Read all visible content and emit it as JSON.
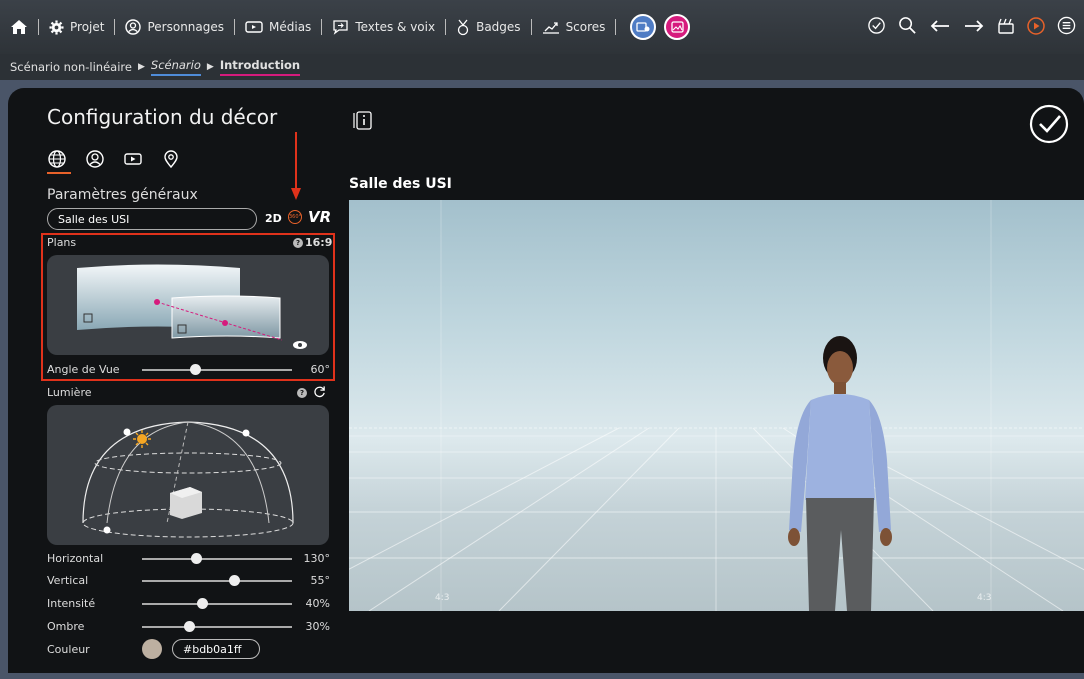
{
  "nav": {
    "projet": "Projet",
    "personnages": "Personnages",
    "medias": "Médias",
    "textes_voix": "Textes & voix",
    "badges": "Badges",
    "scores": "Scores"
  },
  "breadcrumb": {
    "root": "Scénario non-linéaire",
    "scenario": "Scénario",
    "current": "Introduction"
  },
  "panel": {
    "title": "Configuration du décor",
    "section_title": "Paramètres généraux",
    "decor_name": "Salle des USI",
    "mode_2d": "2D",
    "mode_360": "360°",
    "mode_vr": "VR"
  },
  "plans": {
    "label": "Plans",
    "ratio": "16:9",
    "angle_label": "Angle de Vue",
    "angle_value": "60°",
    "angle_level": 0.35
  },
  "lumiere": {
    "label": "Lumière",
    "horizontal_label": "Horizontal",
    "horizontal_value": "130°",
    "horizontal_level": 0.36,
    "vertical_label": "Vertical",
    "vertical_value": "55°",
    "vertical_level": 0.61,
    "intensite_label": "Intensité",
    "intensite_value": "40%",
    "intensite_level": 0.4,
    "ombre_label": "Ombre",
    "ombre_value": "30%",
    "ombre_level": 0.31,
    "couleur_label": "Couleur",
    "couleur_value": "#bdb0a1ff"
  },
  "scene": {
    "title": "Salle des USI",
    "ratio_left": "4:3",
    "ratio_right": "4:3"
  }
}
